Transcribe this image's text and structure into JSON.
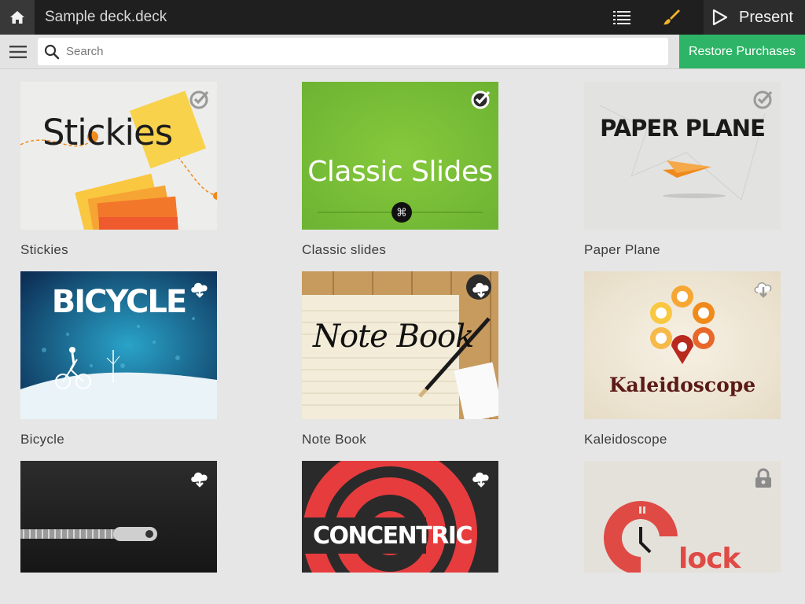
{
  "topbar": {
    "deck_title": "Sample deck.deck",
    "present_label": "Present"
  },
  "search": {
    "placeholder": "Search",
    "value": ""
  },
  "restore_purchases_label": "Restore Purchases",
  "themes": [
    {
      "name": "Stickies",
      "thumb_title": "Stickies",
      "status": "installed"
    },
    {
      "name": "Classic slides",
      "thumb_title": "Classic Slides",
      "status": "installed"
    },
    {
      "name": "Paper Plane",
      "thumb_title": "PAPER PLANE",
      "status": "installed"
    },
    {
      "name": "Bicycle",
      "thumb_title": "BICYCLE",
      "status": "download"
    },
    {
      "name": "Note Book",
      "thumb_title": "Note Book",
      "status": "download"
    },
    {
      "name": "Kaleidoscope",
      "thumb_title": "Kaleidoscope",
      "status": "download"
    },
    {
      "name": "",
      "thumb_title": "",
      "status": "download"
    },
    {
      "name": "",
      "thumb_title": "CONCENTRIC",
      "status": "download"
    },
    {
      "name": "",
      "thumb_title": "lock",
      "status": "locked"
    }
  ],
  "colors": {
    "topbar": "#1f1f1f",
    "accent_green": "#2db466",
    "brush_yellow": "#f0b429"
  },
  "icons": {
    "installed": "check-circle-icon",
    "download": "cloud-download-icon",
    "locked": "lock-icon"
  }
}
